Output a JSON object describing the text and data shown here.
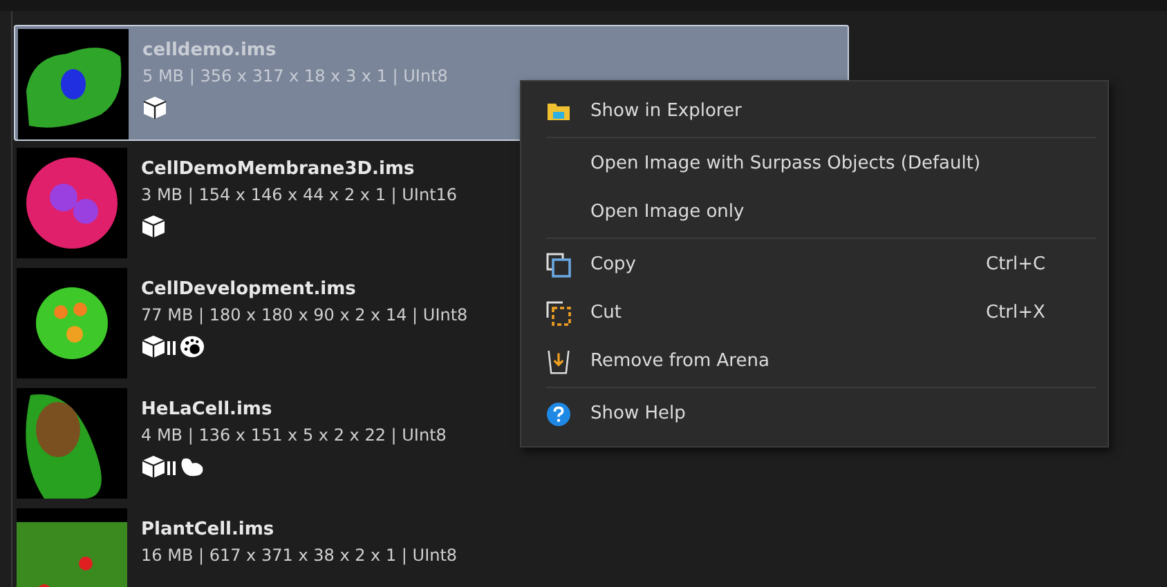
{
  "files": [
    {
      "name": "celldemo.ims",
      "info": "5 MB | 356 x 317 x 18 x 3 x 1 | UInt8",
      "selected": true,
      "badges": [
        {
          "kind": "volume"
        }
      ]
    },
    {
      "name": "CellDemoMembrane3D.ims",
      "info": "3 MB | 154 x 146 x 44 x 2 x 1 | UInt16",
      "selected": false,
      "badges": [
        {
          "kind": "volume"
        }
      ]
    },
    {
      "name": "CellDevelopment.ims",
      "info": "77 MB | 180 x 180 x 90 x 2 x 14 | UInt8",
      "selected": false,
      "badges": [
        {
          "kind": "timeseries"
        },
        {
          "kind": "spots"
        }
      ]
    },
    {
      "name": "HeLaCell.ims",
      "info": "4 MB | 136 x 151 x 5 x 2 x 22 | UInt8",
      "selected": false,
      "badges": [
        {
          "kind": "timeseries"
        },
        {
          "kind": "cells"
        }
      ]
    },
    {
      "name": "PlantCell.ims",
      "info": "16 MB | 617 x 371 x 38 x 2 x 1 | UInt8",
      "selected": false
    }
  ],
  "context_menu": {
    "groups": [
      [
        {
          "label": "Show in Explorer",
          "kind": "folder"
        }
      ],
      [
        {
          "label": "Open Image with Surpass Objects (Default)",
          "kind": "plain"
        },
        {
          "label": "Open Image only",
          "kind": "plain"
        }
      ],
      [
        {
          "label": "Copy",
          "kind": "copy",
          "shortcut": "Ctrl+C"
        },
        {
          "label": "Cut",
          "kind": "cut",
          "shortcut": "Ctrl+X"
        },
        {
          "label": "Remove from Arena",
          "kind": "remove"
        }
      ],
      [
        {
          "label": "Show Help",
          "kind": "help"
        }
      ]
    ]
  }
}
